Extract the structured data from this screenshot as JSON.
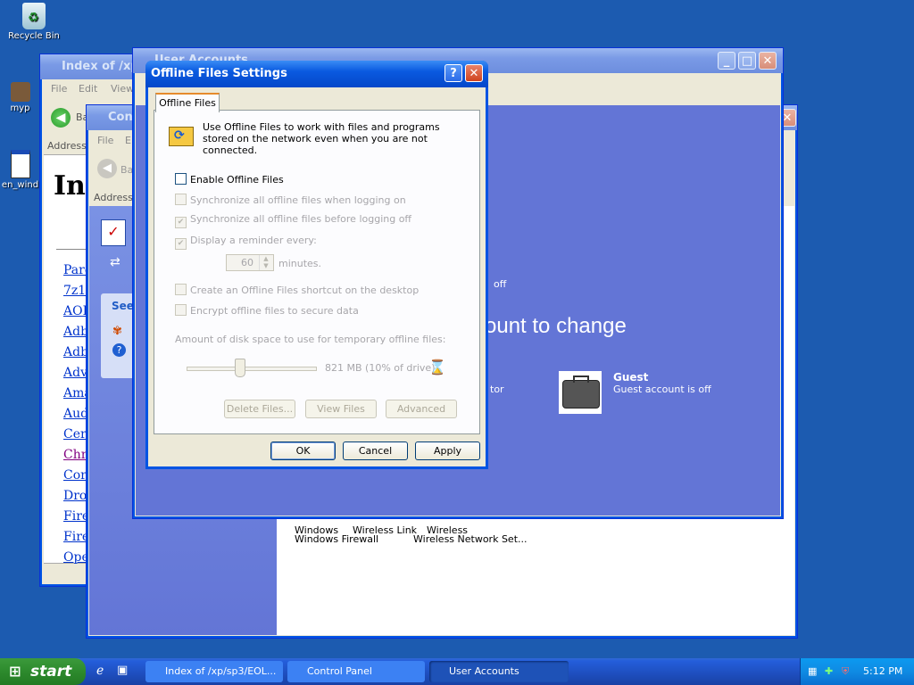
{
  "desktop": {
    "icons": [
      {
        "label": "Recycle Bin"
      },
      {
        "label": "myp"
      },
      {
        "label": "en_wind"
      }
    ]
  },
  "browser_window": {
    "title": "Index of /xp/",
    "menu": [
      "File",
      "Edit",
      "View"
    ],
    "back_label": "Ba",
    "address_label": "Address",
    "heading": "Inc",
    "links": [
      "Pare",
      "7z1",
      "AOI",
      "Adb",
      "Adb",
      "Adv",
      "Ama",
      "Aud",
      "Cer",
      "Chr",
      "Cor",
      "Dro",
      "Fire",
      "Fire",
      "Ope"
    ]
  },
  "control_panel_window": {
    "title": "Con",
    "menu": [
      "File",
      "E"
    ],
    "back_label": "Ba",
    "address_label": "Address",
    "see_also": "See",
    "bottom_items": [
      "Windows Firewall",
      "Wireless Network Set..."
    ],
    "bottom_item_partial": [
      "Windows",
      "Wireless Link",
      "Wireless"
    ]
  },
  "user_accounts_window": {
    "title": "User Accounts",
    "pick_text": "ount to change",
    "off_text": "off",
    "admin_text": "tor",
    "guest": {
      "name": "Guest",
      "status": "Guest account is off"
    }
  },
  "dialog": {
    "title": "Offline Files Settings",
    "tab": "Offline Files",
    "description": "Use Offline Files to work with files and programs stored on the network even when you are not connected.",
    "options": [
      {
        "label": "Enable Offline Files",
        "checked": false,
        "enabled": true
      },
      {
        "label": "Synchronize all offline files when logging on",
        "checked": false,
        "enabled": false
      },
      {
        "label": "Synchronize all offline files before logging off",
        "checked": true,
        "enabled": false
      },
      {
        "label": "Display a reminder every:",
        "checked": true,
        "enabled": false
      }
    ],
    "reminder_value": "60",
    "reminder_unit": "minutes.",
    "options2": [
      {
        "label": "Create an Offline Files shortcut on the desktop",
        "checked": false,
        "enabled": false
      },
      {
        "label": "Encrypt offline files to secure data",
        "checked": false,
        "enabled": false
      }
    ],
    "disk_space_label": "Amount of disk space to use for temporary offline files:",
    "disk_space_value": "821 MB (10% of drive)",
    "disk_space_fraction": 0.1,
    "buttons_inner": [
      "Delete Files...",
      "View Files",
      "Advanced"
    ],
    "buttons_footer": [
      "OK",
      "Cancel",
      "Apply"
    ]
  },
  "taskbar": {
    "start": "start",
    "tasks": [
      {
        "label": "Index of /xp/sp3/EOL...",
        "active": false
      },
      {
        "label": "Control Panel",
        "active": false
      },
      {
        "label": "User Accounts",
        "active": true
      }
    ],
    "clock": "5:12 PM"
  },
  "colors": {
    "desktop": "#1c5bb0",
    "xp_blue": "#0054e3",
    "user_accounts_bg": "#6375d6",
    "start_green": "#2d8a2d"
  }
}
